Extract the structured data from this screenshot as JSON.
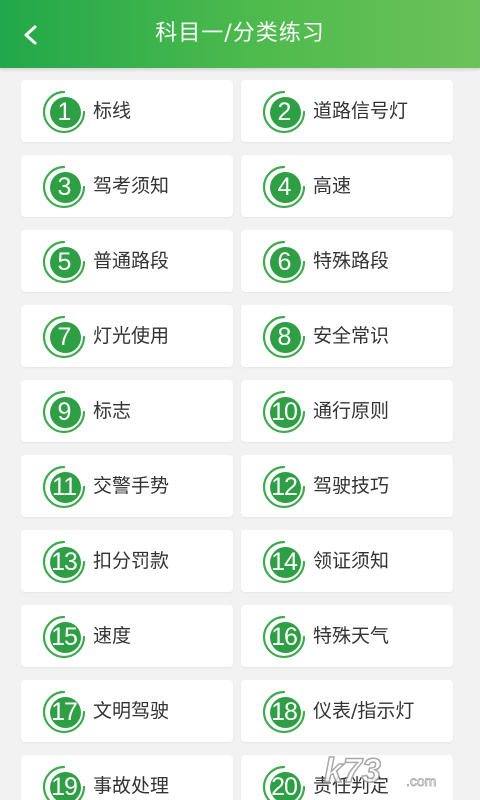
{
  "header": {
    "title": "科目一/分类练习"
  },
  "colors": {
    "header_start": "#21a84a",
    "header_end": "#6cc25a",
    "badge_green": "#2f9f46",
    "ring_green": "#3daa4e"
  },
  "categories": [
    {
      "num": "1",
      "label": "标线"
    },
    {
      "num": "2",
      "label": "道路信号灯"
    },
    {
      "num": "3",
      "label": "驾考须知"
    },
    {
      "num": "4",
      "label": "高速"
    },
    {
      "num": "5",
      "label": "普通路段"
    },
    {
      "num": "6",
      "label": "特殊路段"
    },
    {
      "num": "7",
      "label": "灯光使用"
    },
    {
      "num": "8",
      "label": "安全常识"
    },
    {
      "num": "9",
      "label": "标志"
    },
    {
      "num": "10",
      "label": "通行原则"
    },
    {
      "num": "11",
      "label": "交警手势"
    },
    {
      "num": "12",
      "label": "驾驶技巧"
    },
    {
      "num": "13",
      "label": "扣分罚款"
    },
    {
      "num": "14",
      "label": "领证须知"
    },
    {
      "num": "15",
      "label": "速度"
    },
    {
      "num": "16",
      "label": "特殊天气"
    },
    {
      "num": "17",
      "label": "文明驾驶"
    },
    {
      "num": "18",
      "label": "仪表/指示灯"
    },
    {
      "num": "19",
      "label": "事故处理"
    },
    {
      "num": "20",
      "label": "责任判定"
    }
  ],
  "watermark": {
    "text": "k73.com"
  }
}
